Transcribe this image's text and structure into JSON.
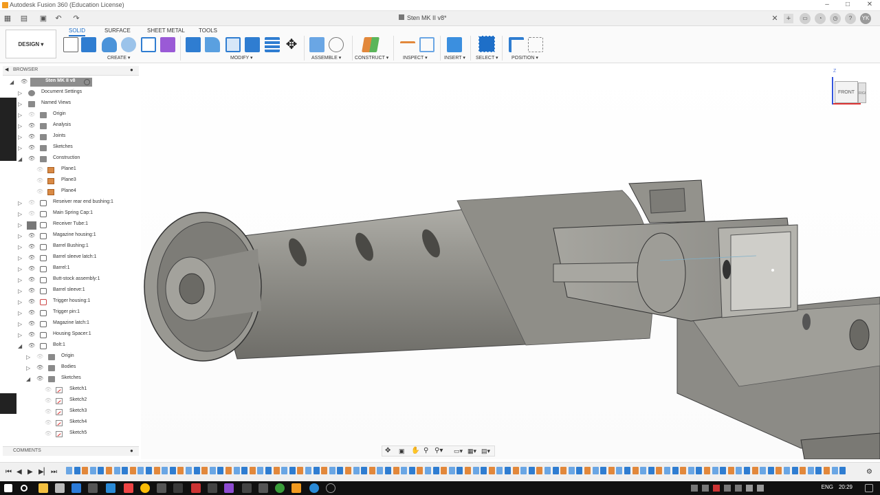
{
  "window": {
    "title": "Autodesk Fusion 360 (Education License)",
    "document_tab": "Sten MK II v8*",
    "user_initials": "YK"
  },
  "toolbar": {
    "workspace": "DESIGN",
    "tabs": [
      "SOLID",
      "SURFACE",
      "SHEET METAL",
      "TOOLS"
    ],
    "groups": [
      "CREATE",
      "MODIFY",
      "ASSEMBLE",
      "CONSTRUCT",
      "INSPECT",
      "INSERT",
      "SELECT",
      "POSITION"
    ]
  },
  "browser": {
    "title": "BROWSER",
    "root": "Sten MK II v8",
    "items": [
      {
        "label": "Document Settings"
      },
      {
        "label": "Named Views"
      },
      {
        "label": "Origin"
      },
      {
        "label": "Analysis"
      },
      {
        "label": "Joints"
      },
      {
        "label": "Sketches"
      },
      {
        "label": "Construction"
      },
      {
        "label": "Plane1"
      },
      {
        "label": "Plane3"
      },
      {
        "label": "Plane4"
      },
      {
        "label": "Reseiver rear end bushing:1"
      },
      {
        "label": "Main Spring Cap:1"
      },
      {
        "label": "Receiver Tube:1"
      },
      {
        "label": "Magazine housing:1"
      },
      {
        "label": "Barrel Bushing:1"
      },
      {
        "label": "Barrel sleeve latch:1"
      },
      {
        "label": "Barrel:1"
      },
      {
        "label": "Butt-stock assembly:1"
      },
      {
        "label": "Barrel sleeve:1"
      },
      {
        "label": "Trigger housing:1"
      },
      {
        "label": "Trigger pin:1"
      },
      {
        "label": "Magazine latch:1"
      },
      {
        "label": "Housing Spacer:1"
      },
      {
        "label": "Bolt:1"
      },
      {
        "label": "Origin"
      },
      {
        "label": "Bodies"
      },
      {
        "label": "Sketches"
      },
      {
        "label": "Sketch1"
      },
      {
        "label": "Sketch2"
      },
      {
        "label": "Sketch3"
      },
      {
        "label": "Sketch4"
      },
      {
        "label": "Sketch5"
      }
    ]
  },
  "comments": {
    "title": "COMMENTS"
  },
  "viewcube": {
    "front": "FRONT",
    "right": "RIGHT",
    "axis": "Z"
  },
  "taskbar": {
    "language": "ENG",
    "time": "20:29"
  },
  "colors": {
    "accent": "#1e6fc8",
    "model": "#8f8e88",
    "brand": "#f29a1f"
  }
}
